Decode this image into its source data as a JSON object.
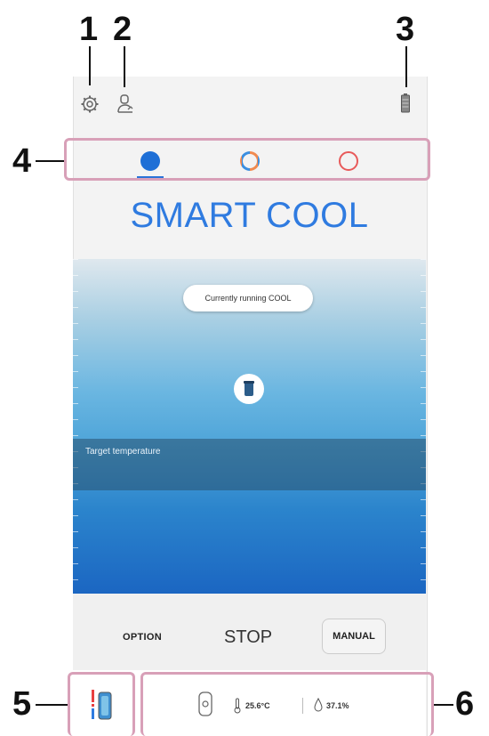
{
  "callouts": [
    "1",
    "2",
    "3",
    "4",
    "5",
    "6"
  ],
  "mode_title": "SMART COOL",
  "status_message": "Currently running COOL",
  "target_label": "Target temperature",
  "controls": {
    "option_label": "OPTION",
    "stop_label": "STOP",
    "manual_label": "MANUAL"
  },
  "readings": {
    "temperature": "25.6°C",
    "humidity": "37.1%"
  },
  "modes": [
    {
      "name": "mode-1",
      "selected": true
    },
    {
      "name": "mode-2",
      "selected": false
    },
    {
      "name": "mode-3",
      "selected": false
    }
  ],
  "colors": {
    "accent_blue": "#2f7be0",
    "callout_border": "#d8a0b8",
    "mode_orange": "#f08a50",
    "mode_red": "#e85a5a"
  },
  "icons": {
    "settings": "gear-icon",
    "profile": "person-icon",
    "battery": "battery-icon",
    "device": "device-icon",
    "thermometer": "thermometer-icon",
    "humidity": "droplet-icon",
    "temp_indicator": "temperature-indicator-icon"
  }
}
